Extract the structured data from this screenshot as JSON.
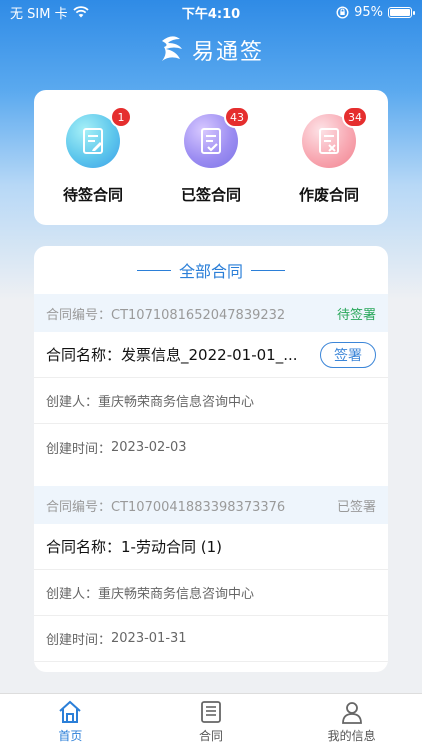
{
  "status_bar": {
    "carrier": "无 SIM 卡",
    "time": "下午4:10",
    "battery": "95%"
  },
  "brand": {
    "name": "易通签"
  },
  "quick_actions": [
    {
      "label": "待签合同",
      "badge": "1",
      "icon": "pending-contract-icon"
    },
    {
      "label": "已签合同",
      "badge": "43",
      "icon": "signed-contract-icon"
    },
    {
      "label": "作废合同",
      "badge": "34",
      "icon": "void-contract-icon"
    }
  ],
  "list": {
    "title": "全部合同",
    "contracts": [
      {
        "number_label": "合同编号：",
        "number": "CT1071081652047839232",
        "status": "待签署",
        "name_label": "合同名称：",
        "name": "发票信息_2022-01-01_...",
        "action": "签署",
        "creator_label": "创建人：",
        "creator": "重庆畅荣商务信息咨询中心",
        "created_label": "创建时间：",
        "created": "2023-02-03"
      },
      {
        "number_label": "合同编号：",
        "number": "CT1070041883398373376",
        "status": "已签署",
        "name_label": "合同名称：",
        "name": "1-劳动合同 (1)",
        "creator_label": "创建人：",
        "creator": "重庆畅荣商务信息咨询中心",
        "created_label": "创建时间：",
        "created": "2023-01-31"
      }
    ]
  },
  "tabbar": [
    {
      "label": "首页",
      "icon": "home-icon",
      "active": true
    },
    {
      "label": "合同",
      "icon": "document-icon",
      "active": false
    },
    {
      "label": "我的信息",
      "icon": "person-icon",
      "active": false
    }
  ],
  "colors": {
    "accent": "#2b7fd8",
    "badge": "#e52e2e",
    "pending_status": "#2aa85b"
  }
}
